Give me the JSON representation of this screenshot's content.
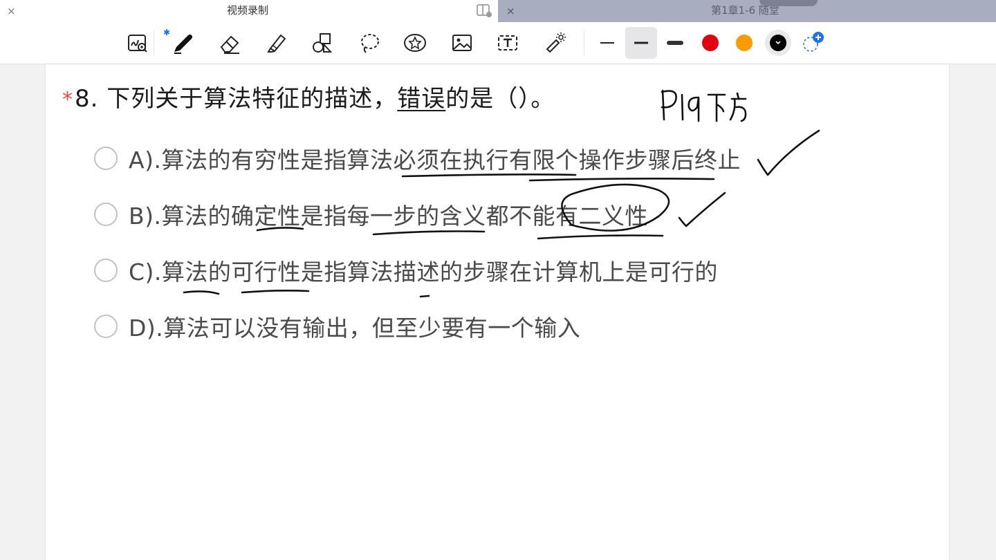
{
  "tabs": {
    "active": {
      "title": "视频录制",
      "close": "×"
    },
    "inactive": {
      "title": "第1章1-6 随堂",
      "close": "×"
    }
  },
  "toolbar": {
    "tools": [
      "zoom-write",
      "pen",
      "eraser",
      "highlighter",
      "shapes",
      "lasso",
      "stickers",
      "image",
      "text",
      "laser-pointer"
    ],
    "bluetooth_indicator": "✱",
    "stroke_widths": [
      "thin",
      "medium",
      "thick"
    ],
    "selected_stroke": "medium",
    "colors": [
      "#e0000f",
      "#ff9a00",
      "#000000"
    ],
    "selected_color": "#000000",
    "add_color": "+"
  },
  "question": {
    "star": "*",
    "number": "8.",
    "text_before": " 下列关于算法特征的描述，",
    "text_underlined": "错误",
    "text_after": "的是（）。"
  },
  "options": [
    {
      "label": "A).算法的有穷性是指算法必须在执行有限个操作步骤后终止"
    },
    {
      "label": "B).算法的确定性是指每一步的含义都不能有二义性"
    },
    {
      "label": "C).算法的可行性是指算法描述的步骤在计算机上是可行的"
    },
    {
      "label": "D).算法可以没有输出，但至少要有一个输入"
    }
  ],
  "handwriting": {
    "page_note": "P19 下方"
  }
}
